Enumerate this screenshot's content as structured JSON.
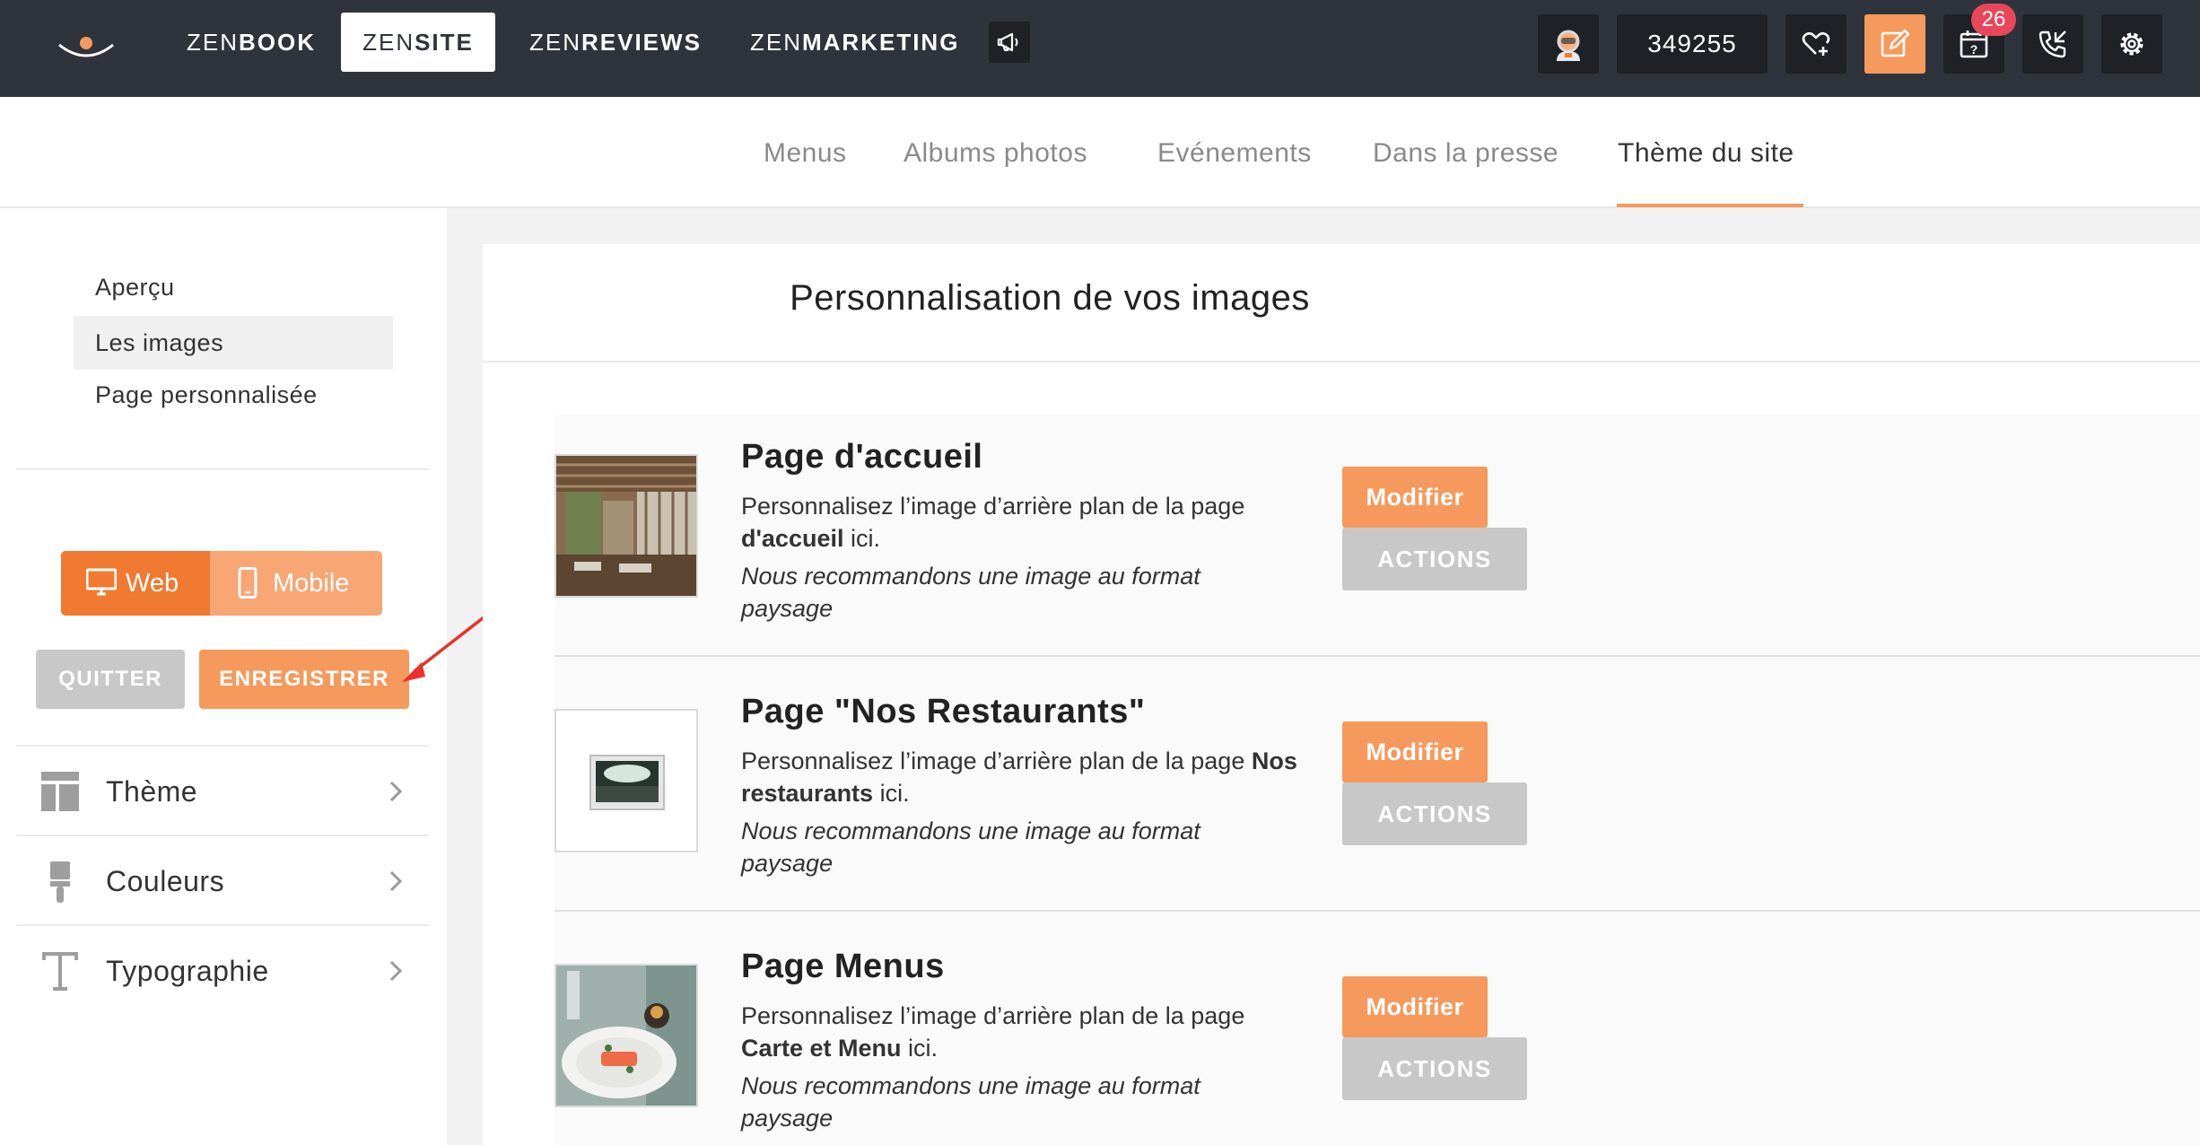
{
  "topbar": {
    "brands": [
      {
        "light": "ZEN",
        "bold": "BOOK"
      },
      {
        "light": "ZEN",
        "bold": "SITE"
      },
      {
        "light": "ZEN",
        "bold": "REVIEWS"
      },
      {
        "light": "ZEN",
        "bold": "MARKETING"
      }
    ],
    "active_brand": "ZENSITE",
    "account_number": "349255",
    "notification_count": "26",
    "icons": [
      "logo-icon",
      "megaphone-icon",
      "avatar-icon",
      "heart-plus-icon",
      "edit-icon",
      "calendar-question-icon",
      "phone-icon",
      "gear-icon"
    ],
    "accent_color": "#f59a5c"
  },
  "subnav": {
    "tabs": [
      "Menus",
      "Albums photos",
      "Evénements",
      "Dans la presse",
      "Thème du site"
    ],
    "active_tab": "Thème du site"
  },
  "sidebar": {
    "items": [
      "Aperçu",
      "Les images",
      "Page personnalisée"
    ],
    "active_item": "Les images",
    "view_toggle": {
      "web": "Web",
      "mobile": "Mobile",
      "selected": "Web"
    },
    "quit_label": "QUITTER",
    "save_label": "ENREGISTRER",
    "accordions": [
      {
        "label": "Thème",
        "icon": "layout-icon"
      },
      {
        "label": "Couleurs",
        "icon": "paintbrush-icon"
      },
      {
        "label": "Typographie",
        "icon": "typography-icon"
      }
    ]
  },
  "main": {
    "title": "Personnalisation de vos images",
    "cards": [
      {
        "title": "Page d'accueil",
        "desc_prefix": "Personnalisez l’image d’arrière plan de la page ",
        "desc_bold": "d'accueil",
        "desc_suffix": " ici.",
        "note": "Nous recommandons une image au format paysage",
        "modify_label": "Modifier",
        "actions_label": "ACTIONS"
      },
      {
        "title": "Page \"Nos Restaurants\"",
        "desc_prefix": "Personnalisez l’image d’arrière plan de la page ",
        "desc_bold": "Nos restaurants",
        "desc_suffix": " ici.",
        "note": "Nous recommandons une image au format paysage",
        "modify_label": "Modifier",
        "actions_label": "ACTIONS"
      },
      {
        "title": "Page Menus",
        "desc_prefix": "Personnalisez l’image d’arrière plan de la page ",
        "desc_bold": "Carte et Menu",
        "desc_suffix": " ici.",
        "note": "Nous recommandons une image au format paysage",
        "modify_label": "Modifier",
        "actions_label": "ACTIONS"
      }
    ]
  }
}
